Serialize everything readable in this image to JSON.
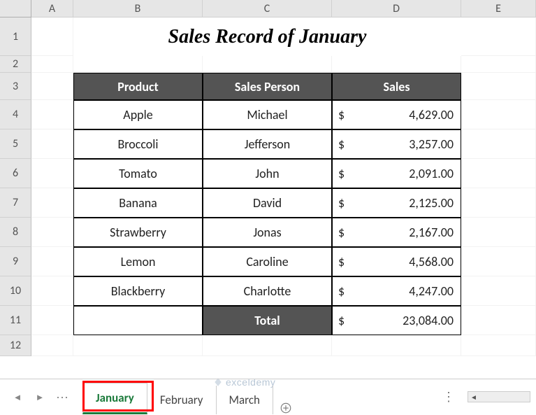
{
  "columns": [
    "A",
    "B",
    "C",
    "D",
    "E"
  ],
  "rows": [
    "1",
    "2",
    "3",
    "4",
    "5",
    "6",
    "7",
    "8",
    "9",
    "10",
    "11",
    "12"
  ],
  "title": "Sales Record of January",
  "headers": {
    "product": "Product",
    "person": "Sales Person",
    "sales": "Sales"
  },
  "currency": "$",
  "data": [
    {
      "product": "Apple",
      "person": "Michael",
      "sales": "4,629.00"
    },
    {
      "product": "Broccoli",
      "person": "Jefferson",
      "sales": "3,257.00"
    },
    {
      "product": "Tomato",
      "person": "John",
      "sales": "2,091.00"
    },
    {
      "product": "Banana",
      "person": "David",
      "sales": "2,125.00"
    },
    {
      "product": "Strawberry",
      "person": "Jonas",
      "sales": "2,167.00"
    },
    {
      "product": "Lemon",
      "person": "Caroline",
      "sales": "4,568.00"
    },
    {
      "product": "Blackberry",
      "person": "Charlotte",
      "sales": "4,247.00"
    }
  ],
  "total": {
    "label": "Total",
    "value": "23,084.00"
  },
  "tabs": [
    {
      "label": "January",
      "active": true
    },
    {
      "label": "February",
      "active": false
    },
    {
      "label": "March",
      "active": false
    }
  ],
  "watermark": "exceldemy"
}
